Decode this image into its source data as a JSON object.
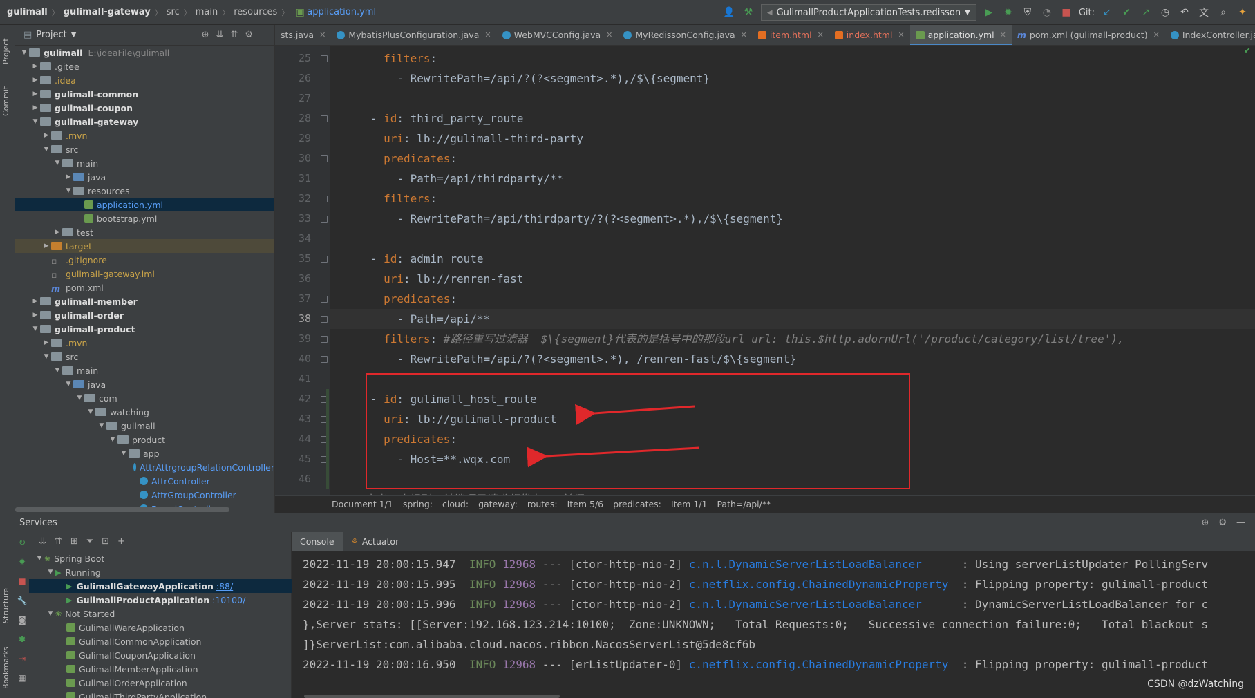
{
  "breadcrumb": [
    "gulimall",
    "gulimall-gateway",
    "src",
    "main",
    "resources",
    "application.yml"
  ],
  "run_config": "GulimallProductApplicationTests.redisson",
  "git_label": "Git:",
  "project_panel": {
    "title": "Project",
    "tree": [
      {
        "label": "gulimall",
        "extra": "E:\\ideaFile\\gulimall",
        "depth": 0,
        "arrow": "open",
        "icon": "folder",
        "style": "bold"
      },
      {
        "label": ".gitee",
        "depth": 1,
        "arrow": "closed",
        "icon": "folder"
      },
      {
        "label": ".idea",
        "depth": 1,
        "arrow": "closed",
        "icon": "folder",
        "style": "orange"
      },
      {
        "label": "gulimall-common",
        "depth": 1,
        "arrow": "closed",
        "icon": "folder",
        "style": "bold"
      },
      {
        "label": "gulimall-coupon",
        "depth": 1,
        "arrow": "closed",
        "icon": "folder",
        "style": "bold"
      },
      {
        "label": "gulimall-gateway",
        "depth": 1,
        "arrow": "open",
        "icon": "folder",
        "style": "bold"
      },
      {
        "label": ".mvn",
        "depth": 2,
        "arrow": "closed",
        "icon": "folder",
        "style": "orange"
      },
      {
        "label": "src",
        "depth": 2,
        "arrow": "open",
        "icon": "folder"
      },
      {
        "label": "main",
        "depth": 3,
        "arrow": "open",
        "icon": "folder"
      },
      {
        "label": "java",
        "depth": 4,
        "arrow": "closed",
        "icon": "folder-blue"
      },
      {
        "label": "resources",
        "depth": 4,
        "arrow": "open",
        "icon": "folder"
      },
      {
        "label": "application.yml",
        "depth": 5,
        "arrow": "none",
        "icon": "yml",
        "style": "blue",
        "selected": true
      },
      {
        "label": "bootstrap.yml",
        "depth": 5,
        "arrow": "none",
        "icon": "yml"
      },
      {
        "label": "test",
        "depth": 3,
        "arrow": "closed",
        "icon": "folder"
      },
      {
        "label": "target",
        "depth": 2,
        "arrow": "closed",
        "icon": "folder-orange",
        "style": "orange",
        "highlight": true
      },
      {
        "label": ".gitignore",
        "depth": 2,
        "arrow": "none",
        "icon": "file",
        "style": "orange"
      },
      {
        "label": "gulimall-gateway.iml",
        "depth": 2,
        "arrow": "none",
        "icon": "file",
        "style": "orange"
      },
      {
        "label": "pom.xml",
        "depth": 2,
        "arrow": "none",
        "icon": "maven"
      },
      {
        "label": "gulimall-member",
        "depth": 1,
        "arrow": "closed",
        "icon": "folder",
        "style": "bold"
      },
      {
        "label": "gulimall-order",
        "depth": 1,
        "arrow": "closed",
        "icon": "folder",
        "style": "bold"
      },
      {
        "label": "gulimall-product",
        "depth": 1,
        "arrow": "open",
        "icon": "folder",
        "style": "bold"
      },
      {
        "label": ".mvn",
        "depth": 2,
        "arrow": "closed",
        "icon": "folder",
        "style": "orange"
      },
      {
        "label": "src",
        "depth": 2,
        "arrow": "open",
        "icon": "folder"
      },
      {
        "label": "main",
        "depth": 3,
        "arrow": "open",
        "icon": "folder"
      },
      {
        "label": "java",
        "depth": 4,
        "arrow": "open",
        "icon": "folder-blue"
      },
      {
        "label": "com",
        "depth": 5,
        "arrow": "open",
        "icon": "folder"
      },
      {
        "label": "watching",
        "depth": 6,
        "arrow": "open",
        "icon": "folder"
      },
      {
        "label": "gulimall",
        "depth": 7,
        "arrow": "open",
        "icon": "folder"
      },
      {
        "label": "product",
        "depth": 8,
        "arrow": "open",
        "icon": "folder"
      },
      {
        "label": "app",
        "depth": 9,
        "arrow": "open",
        "icon": "folder"
      },
      {
        "label": "AttrAttrgroupRelationController",
        "depth": 10,
        "arrow": "none",
        "icon": "class",
        "style": "blue"
      },
      {
        "label": "AttrController",
        "depth": 10,
        "arrow": "none",
        "icon": "class",
        "style": "blue"
      },
      {
        "label": "AttrGroupController",
        "depth": 10,
        "arrow": "none",
        "icon": "class",
        "style": "blue"
      },
      {
        "label": "BrandController",
        "depth": 10,
        "arrow": "none",
        "icon": "class",
        "style": "blue"
      }
    ]
  },
  "side_tabs": {
    "project": "Project",
    "commit": "Commit",
    "structure": "Structure",
    "bookmarks": "Bookmarks"
  },
  "editor_tabs": [
    {
      "label": "sts.java",
      "icon": "none"
    },
    {
      "label": "MybatisPlusConfiguration.java",
      "icon": "class"
    },
    {
      "label": "WebMVCConfig.java",
      "icon": "class"
    },
    {
      "label": "MyRedissonConfig.java",
      "icon": "class"
    },
    {
      "label": "item.html",
      "icon": "html",
      "red": true
    },
    {
      "label": "index.html",
      "icon": "html",
      "red": true
    },
    {
      "label": "application.yml",
      "icon": "yml",
      "active": true
    },
    {
      "label": "pom.xml (gulimall-product)",
      "icon": "maven"
    },
    {
      "label": "IndexController.java",
      "icon": "class"
    }
  ],
  "code": {
    "first_line": 25,
    "current_line": 38,
    "lines": [
      [
        {
          "t": "        "
        },
        {
          "t": "filters",
          "k": 1
        },
        {
          "t": ":"
        }
      ],
      [
        {
          "t": "          - RewritePath=/api/?(?<segment>.*),/$\\{segment}"
        }
      ],
      [
        {
          "t": ""
        }
      ],
      [
        {
          "t": "      - "
        },
        {
          "t": "id",
          "k": 1
        },
        {
          "t": ": third_party_route"
        }
      ],
      [
        {
          "t": "        "
        },
        {
          "t": "uri",
          "k": 1
        },
        {
          "t": ": lb://gulimall-third-party"
        }
      ],
      [
        {
          "t": "        "
        },
        {
          "t": "predicates",
          "k": 1
        },
        {
          "t": ":"
        }
      ],
      [
        {
          "t": "          - Path=/api/thirdparty/**"
        }
      ],
      [
        {
          "t": "        "
        },
        {
          "t": "filters",
          "k": 1
        },
        {
          "t": ":"
        }
      ],
      [
        {
          "t": "          - RewritePath=/api/thirdparty/?(?<segment>.*),/$\\{segment}"
        }
      ],
      [
        {
          "t": ""
        }
      ],
      [
        {
          "t": "      - "
        },
        {
          "t": "id",
          "k": 1
        },
        {
          "t": ": admin_route"
        }
      ],
      [
        {
          "t": "        "
        },
        {
          "t": "uri",
          "k": 1
        },
        {
          "t": ": lb://renren-fast"
        }
      ],
      [
        {
          "t": "        "
        },
        {
          "t": "predicates",
          "k": 1
        },
        {
          "t": ":"
        }
      ],
      [
        {
          "t": "          - Path=/api/**"
        }
      ],
      [
        {
          "t": "        "
        },
        {
          "t": "filters",
          "k": 1
        },
        {
          "t": ": "
        },
        {
          "t": "#路径重写过滤器  $\\{segment}代表的是括号中的那段url url: this.$http.adornUrl('/product/category/list/tree'),",
          "c": 1
        }
      ],
      [
        {
          "t": "          - RewritePath=/api/?(?<segment>.*), /renren-fast/$\\{segment}"
        }
      ],
      [
        {
          "t": ""
        }
      ],
      [
        {
          "t": "      - "
        },
        {
          "t": "id",
          "k": 1
        },
        {
          "t": ": gulimall_host_route"
        }
      ],
      [
        {
          "t": "        "
        },
        {
          "t": "uri",
          "k": 1
        },
        {
          "t": ": lb://gulimall-product"
        }
      ],
      [
        {
          "t": "        "
        },
        {
          "t": "predicates",
          "k": 1
        },
        {
          "t": ":"
        }
      ],
      [
        {
          "t": "          - Host=**.wqx.com"
        }
      ],
      [
        {
          "t": ""
        }
      ],
      [
        {
          "t": "    #定义一个规则，前端项目请求都带有api前缀",
          "c": 1
        }
      ]
    ]
  },
  "editor_breadcrumb": [
    "Document 1/1",
    "spring:",
    "cloud:",
    "gateway:",
    "routes:",
    "Item 5/6",
    "predicates:",
    "Item 1/1",
    "Path=/api/**"
  ],
  "services": {
    "title": "Services",
    "tree": [
      {
        "label": "Spring Boot",
        "depth": 0,
        "arrow": "open",
        "kind": "group"
      },
      {
        "label": "Running",
        "depth": 1,
        "arrow": "open",
        "kind": "running"
      },
      {
        "label": "GulimallGatewayApplication",
        "port": ":88/",
        "depth": 2,
        "kind": "app-run",
        "selected": true
      },
      {
        "label": "GulimallProductApplication",
        "port": ":10100/",
        "depth": 2,
        "kind": "app-run"
      },
      {
        "label": "Not Started",
        "depth": 1,
        "arrow": "open",
        "kind": "group"
      },
      {
        "label": "GulimallWareApplication",
        "depth": 2,
        "kind": "app"
      },
      {
        "label": "GulimallCommonApplication",
        "depth": 2,
        "kind": "app"
      },
      {
        "label": "GulimallCouponApplication",
        "depth": 2,
        "kind": "app"
      },
      {
        "label": "GulimallMemberApplication",
        "depth": 2,
        "kind": "app"
      },
      {
        "label": "GulimallOrderApplication",
        "depth": 2,
        "kind": "app"
      },
      {
        "label": "GulimallThirdPartyApplication",
        "depth": 2,
        "kind": "app"
      }
    ]
  },
  "console": {
    "tabs": [
      "Console",
      "Actuator"
    ],
    "lines": [
      [
        {
          "t": "2022-11-19 20:00:15.947  "
        },
        {
          "t": "INFO",
          "s": "info"
        },
        {
          "t": " "
        },
        {
          "t": "12968",
          "s": "pid"
        },
        {
          "t": " --- [ctor-http-nio-2] "
        },
        {
          "t": "c.n.l.DynamicServerListLoadBalancer",
          "s": "lnk"
        },
        {
          "t": "      : Using serverListUpdater PollingServ"
        }
      ],
      [
        {
          "t": "2022-11-19 20:00:15.995  "
        },
        {
          "t": "INFO",
          "s": "info"
        },
        {
          "t": " "
        },
        {
          "t": "12968",
          "s": "pid"
        },
        {
          "t": " --- [ctor-http-nio-2] "
        },
        {
          "t": "c.netflix.config.ChainedDynamicProperty",
          "s": "lnk"
        },
        {
          "t": "  : Flipping property: gulimall-product"
        }
      ],
      [
        {
          "t": "2022-11-19 20:00:15.996  "
        },
        {
          "t": "INFO",
          "s": "info"
        },
        {
          "t": " "
        },
        {
          "t": "12968",
          "s": "pid"
        },
        {
          "t": " --- [ctor-http-nio-2] "
        },
        {
          "t": "c.n.l.DynamicServerListLoadBalancer",
          "s": "lnk"
        },
        {
          "t": "      : DynamicServerListLoadBalancer for c"
        }
      ],
      [
        {
          "t": "},Server stats: [[Server:192.168.123.214:10100;  Zone:UNKNOWN;   Total Requests:0;   Successive connection failure:0;   Total blackout s"
        }
      ],
      [
        {
          "t": "]}ServerList:com.alibaba.cloud.nacos.ribbon.NacosServerList@5de8cf6b"
        }
      ],
      [
        {
          "t": "2022-11-19 20:00:16.950  "
        },
        {
          "t": "INFO",
          "s": "info"
        },
        {
          "t": " "
        },
        {
          "t": "12968",
          "s": "pid"
        },
        {
          "t": " --- [erListUpdater-0] "
        },
        {
          "t": "c.netflix.config.ChainedDynamicProperty",
          "s": "lnk"
        },
        {
          "t": "  : Flipping property: gulimall-product"
        }
      ]
    ]
  },
  "watermark": "CSDN @dzWatching",
  "colors": {
    "accent": "#4a88c7",
    "annotation": "#e0282b",
    "keyword": "#cc7832",
    "comment": "#808080",
    "link": "#287bde"
  }
}
